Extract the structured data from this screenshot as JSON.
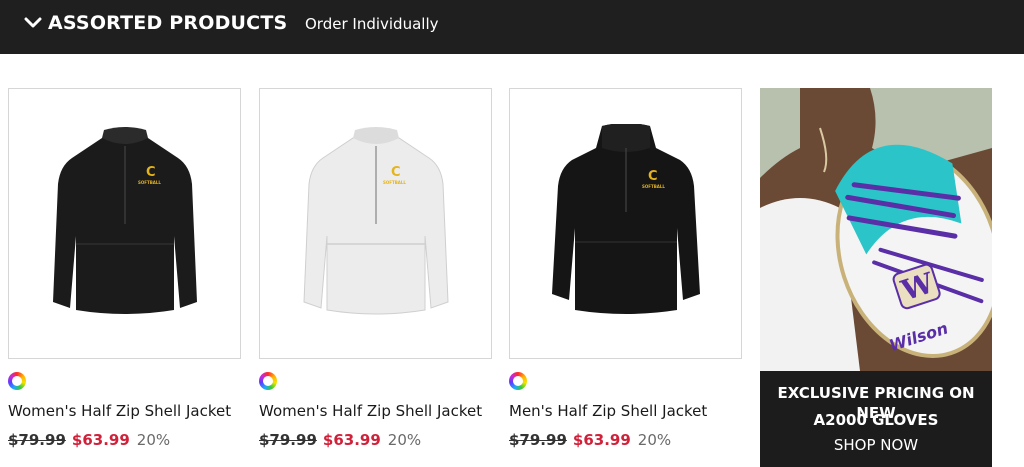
{
  "section": {
    "title": "ASSORTED PRODUCTS",
    "toggle_icon": "chevron-down-icon",
    "order_link": "Order Individually"
  },
  "products": [
    {
      "name": "Women's Half Zip Shell Jacket",
      "old_price": "$79.99",
      "price": "$63.99",
      "discount": "20%",
      "image": "black-half-zip-jacket",
      "jacket_color": "#1b1b1b",
      "logo_text": "C",
      "logo_sub": "SOFTBALL",
      "logo_color": "#e5b31a"
    },
    {
      "name": "Women's Half Zip Shell Jacket",
      "old_price": "$79.99",
      "price": "$63.99",
      "discount": "20%",
      "image": "white-half-zip-jacket",
      "jacket_color": "#eeeeee",
      "logo_text": "C",
      "logo_sub": "SOFTBALL",
      "logo_color": "#e5b31a"
    },
    {
      "name": "Men's Half Zip Shell Jacket",
      "old_price": "$79.99",
      "price": "$63.99",
      "discount": "20%",
      "image": "black-hooded-half-zip-jacket",
      "jacket_color": "#151515",
      "logo_text": "C",
      "logo_sub": "SOFTBALL",
      "logo_color": "#e5b31a"
    }
  ],
  "swatch_icon": "color-wheel-icon",
  "promo": {
    "line1": "EXCLUSIVE PRICING ON NEW",
    "line2": "A2000 GLOVES",
    "cta": "SHOP NOW",
    "glove_brand": "Wilson",
    "glove_logo": "W"
  },
  "colors": {
    "topbar": "#1f1f1f",
    "sale_red": "#d0213a",
    "promo_bar": "#1c1c1c",
    "glove_teal": "#2bc4c9",
    "glove_purple": "#5a2ea6"
  }
}
